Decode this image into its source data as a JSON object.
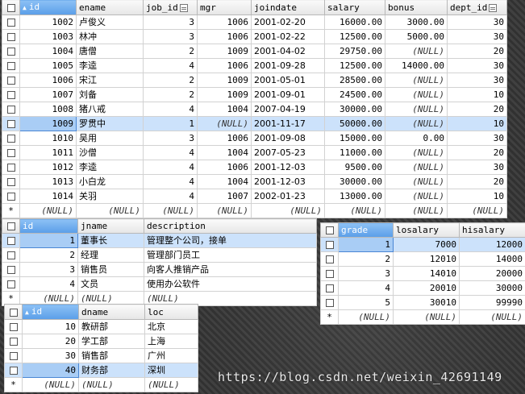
{
  "emp": {
    "columns": [
      "id",
      "ename",
      "job_id",
      "mgr",
      "joindate",
      "salary",
      "bonus",
      "dept_id"
    ],
    "rows": [
      [
        "1002",
        "卢俊义",
        "3",
        "1006",
        "2001-02-20",
        "16000.00",
        "3000.00",
        "30"
      ],
      [
        "1003",
        "林冲",
        "3",
        "1006",
        "2001-02-22",
        "12500.00",
        "5000.00",
        "30"
      ],
      [
        "1004",
        "唐僧",
        "2",
        "1009",
        "2001-04-02",
        "29750.00",
        "(NULL)",
        "20"
      ],
      [
        "1005",
        "李逵",
        "4",
        "1006",
        "2001-09-28",
        "12500.00",
        "14000.00",
        "30"
      ],
      [
        "1006",
        "宋江",
        "2",
        "1009",
        "2001-05-01",
        "28500.00",
        "(NULL)",
        "30"
      ],
      [
        "1007",
        "刘备",
        "2",
        "1009",
        "2001-09-01",
        "24500.00",
        "(NULL)",
        "10"
      ],
      [
        "1008",
        "猪八戒",
        "4",
        "1004",
        "2007-04-19",
        "30000.00",
        "(NULL)",
        "20"
      ],
      [
        "1009",
        "罗贯中",
        "1",
        "(NULL)",
        "2001-11-17",
        "50000.00",
        "(NULL)",
        "10"
      ],
      [
        "1010",
        "吴用",
        "3",
        "1006",
        "2001-09-08",
        "15000.00",
        "0.00",
        "30"
      ],
      [
        "1011",
        "沙僧",
        "4",
        "1004",
        "2007-05-23",
        "11000.00",
        "(NULL)",
        "20"
      ],
      [
        "1012",
        "李逵",
        "4",
        "1006",
        "2001-12-03",
        "9500.00",
        "(NULL)",
        "30"
      ],
      [
        "1013",
        "小白龙",
        "4",
        "1004",
        "2001-12-03",
        "30000.00",
        "(NULL)",
        "20"
      ],
      [
        "1014",
        "关羽",
        "4",
        "1007",
        "2002-01-23",
        "13000.00",
        "(NULL)",
        "10"
      ]
    ],
    "new_row": [
      "(NULL)",
      "(NULL)",
      "(NULL)",
      "(NULL)",
      "(NULL)",
      "(NULL)",
      "(NULL)",
      "(NULL)"
    ],
    "new_row_marker": "*"
  },
  "job": {
    "columns": [
      "id",
      "jname",
      "description"
    ],
    "rows": [
      [
        "1",
        "董事长",
        "管理整个公司，接单"
      ],
      [
        "2",
        "经理",
        "管理部门员工"
      ],
      [
        "3",
        "销售员",
        "向客人推销产品"
      ],
      [
        "4",
        "文员",
        "使用办公软件"
      ]
    ],
    "new_row": [
      "(NULL)",
      "(NULL)",
      "(NULL)"
    ],
    "new_row_marker": "*"
  },
  "dept": {
    "columns": [
      "id",
      "dname",
      "loc"
    ],
    "rows": [
      [
        "10",
        "教研部",
        "北京"
      ],
      [
        "20",
        "学工部",
        "上海"
      ],
      [
        "30",
        "销售部",
        "广州"
      ],
      [
        "40",
        "财务部",
        "深圳"
      ]
    ],
    "new_row": [
      "(NULL)",
      "(NULL)",
      "(NULL)"
    ],
    "new_row_marker": "*"
  },
  "salarygrade": {
    "columns": [
      "grade",
      "losalary",
      "hisalary"
    ],
    "rows": [
      [
        "1",
        "7000",
        "12000"
      ],
      [
        "2",
        "12010",
        "14000"
      ],
      [
        "3",
        "14010",
        "20000"
      ],
      [
        "4",
        "20010",
        "30000"
      ],
      [
        "5",
        "30010",
        "99990"
      ]
    ],
    "new_row": [
      "(NULL)",
      "(NULL)",
      "(NULL)"
    ],
    "new_row_marker": "*"
  },
  "watermark": "https://blog.csdn.net/weixin_42691149",
  "colors": {
    "selection": "#cce2fb",
    "sorted_header": "#5a9ee8"
  }
}
